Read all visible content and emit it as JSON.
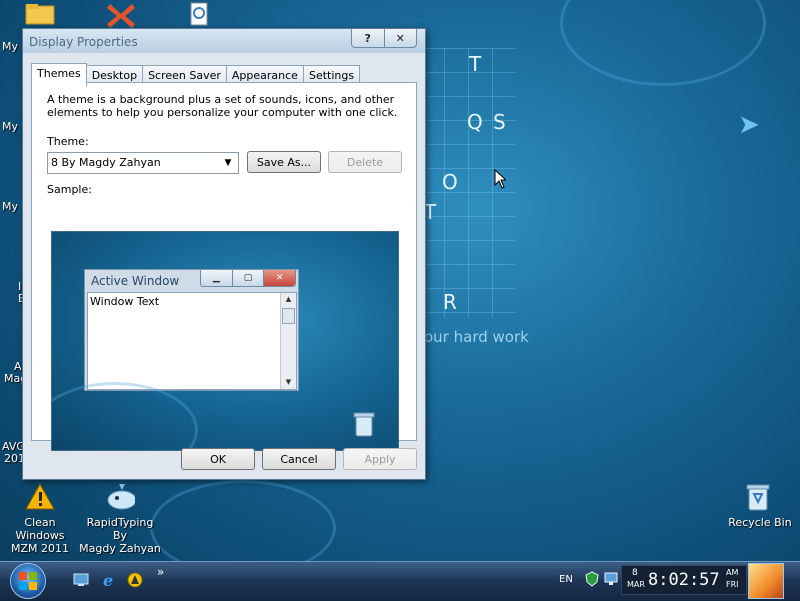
{
  "desktop": {
    "wallpaper": {
      "grid_letters": [
        "T",
        "Q",
        "S",
        "O",
        "T",
        "R"
      ],
      "tagline": "our hard work"
    },
    "edge_labels": [
      "My",
      "My",
      "My",
      "I",
      "E",
      "A",
      "Mag",
      "AVG",
      "201"
    ],
    "icons": {
      "clean_windows": "Clean Windows\nMZM 2011",
      "rapidtyping": "RapidTyping By\nMagdy Zahyan",
      "recycle_bin": "Recycle Bin"
    }
  },
  "dialog": {
    "title": "Display Properties",
    "help_btn": "?",
    "close_btn": "✕",
    "tabs": [
      "Themes",
      "Desktop",
      "Screen Saver",
      "Appearance",
      "Settings"
    ],
    "active_tab": "Themes",
    "description": "A theme is a background plus a set of sounds, icons, and other elements to help you personalize your computer with one click.",
    "theme_label": "Theme:",
    "theme_value": "8 By Magdy Zahyan",
    "save_as": "Save As...",
    "delete": "Delete",
    "sample_label": "Sample:",
    "sample": {
      "window_title": "Active Window",
      "window_text": "Window Text"
    },
    "ok": "OK",
    "cancel": "Cancel",
    "apply": "Apply"
  },
  "taskbar": {
    "quick_launch_more": "»",
    "language": "EN",
    "clock": {
      "day": "8",
      "month": "MAR",
      "time": "8:02:57",
      "ampm": "AM",
      "weekday": "FRI"
    }
  },
  "colors": {
    "accent": "#1a6a9a",
    "close_red": "#c7443a",
    "title_text": "#4a6a88"
  }
}
